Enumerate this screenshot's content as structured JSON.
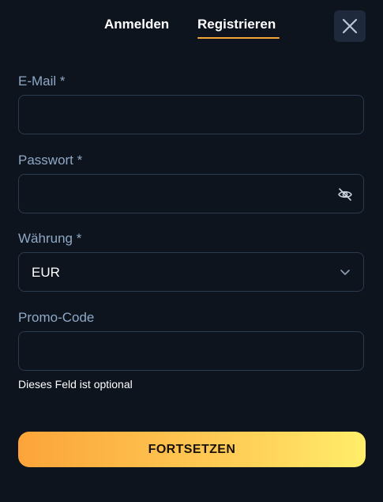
{
  "tabs": {
    "login_label": "Anmelden",
    "register_label": "Registrieren",
    "active": "register"
  },
  "close": {
    "icon": "close-icon"
  },
  "form": {
    "email": {
      "label": "E-Mail *",
      "value": "",
      "placeholder": ""
    },
    "password": {
      "label": "Passwort *",
      "value": "",
      "placeholder": "",
      "toggle_icon": "eye-off-icon"
    },
    "currency": {
      "label": "Währung *",
      "selected": "EUR",
      "icon": "chevron-down-icon"
    },
    "promo": {
      "label": "Promo-Code",
      "value": "",
      "placeholder": "",
      "hint": "Dieses Feld ist optional"
    },
    "submit_label": "FORTSETZEN"
  },
  "colors": {
    "background": "#0d141e",
    "accent": "#f6a43a",
    "label": "#8fa8c6",
    "input_border": "#2b3a4f",
    "button_gradient_start": "#fca43a",
    "button_gradient_end": "#ffee6a"
  }
}
